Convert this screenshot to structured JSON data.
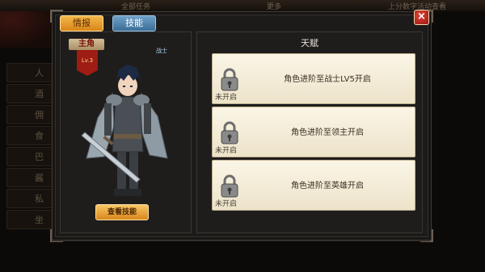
{
  "background": {
    "topbar_texts": [
      "全部任务",
      "更多",
      "上分数字活动查看"
    ],
    "side_labels": [
      "人",
      "酒",
      "佣",
      "食",
      "巴",
      "酱",
      "私",
      "坐"
    ]
  },
  "dialog": {
    "tabs": [
      {
        "label": "情报",
        "active": true
      },
      {
        "label": "技能",
        "active": false
      }
    ],
    "close_icon": "×"
  },
  "hero": {
    "name": "主角",
    "level": "Lv.3",
    "class": "战士",
    "view_skills_label": "查看技能"
  },
  "talent": {
    "title": "天赋",
    "items": [
      {
        "text": "角色进阶至战士LV5开启",
        "status": "未开启"
      },
      {
        "text": "角色进阶至领主开启",
        "status": "未开启"
      },
      {
        "text": "角色进阶至英雄开启",
        "status": "未开启"
      }
    ]
  },
  "colors": {
    "tab_active": "#e09a2a",
    "tab_inactive": "#4b7ba3",
    "close_button": "#c42a1e",
    "card_bg": "#f5efdc"
  }
}
